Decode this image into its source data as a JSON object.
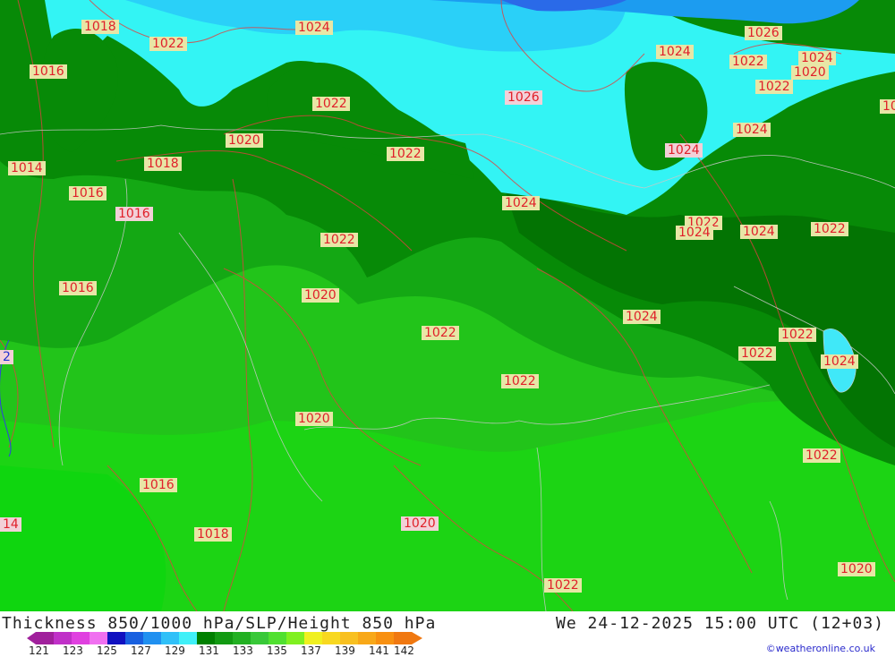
{
  "title": "Thickness 850/1000 hPa/SLP/Height 850 hPa",
  "datetime": "We 24-12-2025 15:00 UTC (12+03)",
  "credit": "©weatheronline.co.uk",
  "colorscale": {
    "ticks": [
      "121",
      "123",
      "125",
      "127",
      "129",
      "131",
      "133",
      "135",
      "137",
      "139",
      "141",
      "142"
    ],
    "colors": [
      "#a0209c",
      "#c030c8",
      "#e040e0",
      "#f070f0",
      "#1010c0",
      "#1860e0",
      "#2090f0",
      "#30c0f8",
      "#40f0f8",
      "#008000",
      "#129a12",
      "#22b022",
      "#38c838",
      "#50e030",
      "#80f020",
      "#f0f020",
      "#f8d820",
      "#f8c020",
      "#f8a818",
      "#f89010",
      "#f07810"
    ]
  },
  "isobars": [
    {
      "text": "1018"
    },
    {
      "text": "1022"
    },
    {
      "text": "1024"
    },
    {
      "text": "1016"
    },
    {
      "text": "1022"
    },
    {
      "text": "1026"
    },
    {
      "text": "1024"
    },
    {
      "text": "1026"
    },
    {
      "text": "1022"
    },
    {
      "text": "1024"
    },
    {
      "text": "1020"
    },
    {
      "text": "1022"
    },
    {
      "text": "1020"
    },
    {
      "text": "1024"
    },
    {
      "text": "1014"
    },
    {
      "text": "1018"
    },
    {
      "text": "1022"
    },
    {
      "text": "1024"
    },
    {
      "text": "1016"
    },
    {
      "text": "1016"
    },
    {
      "text": "1024"
    },
    {
      "text": "1022"
    },
    {
      "text": "1024"
    },
    {
      "text": "1022"
    },
    {
      "text": "1024"
    },
    {
      "text": "1022"
    },
    {
      "text": "1016"
    },
    {
      "text": "1020"
    },
    {
      "text": "1022"
    },
    {
      "text": "1024"
    },
    {
      "text": "1022"
    },
    {
      "text": "1022"
    },
    {
      "text": "1024"
    },
    {
      "text": "1022"
    },
    {
      "text": "1020"
    },
    {
      "text": "1022"
    },
    {
      "text": "1016"
    },
    {
      "text": "14"
    },
    {
      "text": "1018"
    },
    {
      "text": "1020"
    },
    {
      "text": "1020"
    },
    {
      "text": "1022"
    },
    {
      "text": "1022"
    },
    {
      "text": "2"
    },
    {
      "text": "10"
    }
  ]
}
